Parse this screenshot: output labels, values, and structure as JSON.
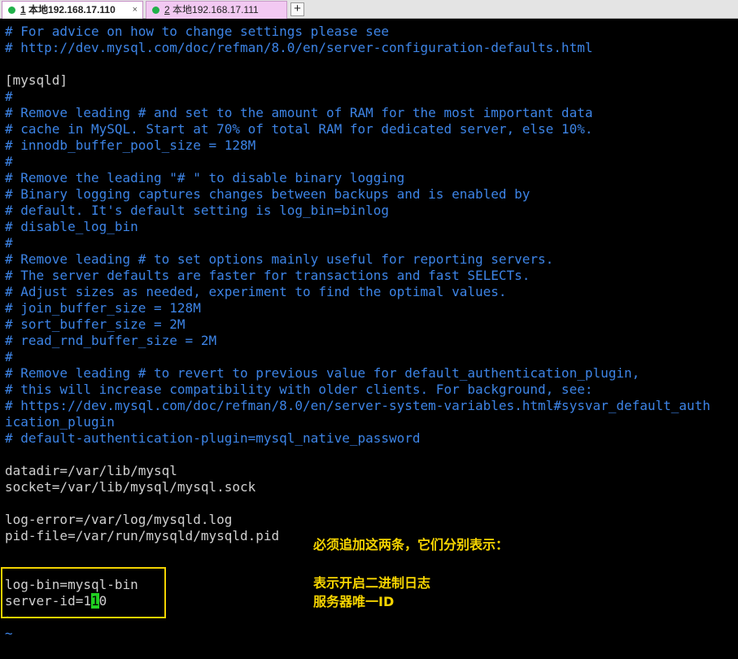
{
  "tabs": [
    {
      "num": "1",
      "label": " 本地192.168.17.110",
      "close": "×"
    },
    {
      "num": "2",
      "label": " 本地192.168.17.111"
    }
  ],
  "new_tab_label": "+",
  "lines": [
    {
      "text": "# For advice on how to change settings please see",
      "comment": true
    },
    {
      "text": "# http://dev.mysql.com/doc/refman/8.0/en/server-configuration-defaults.html",
      "comment": true
    },
    {
      "text": "",
      "comment": false
    },
    {
      "text": "[mysqld]",
      "comment": false
    },
    {
      "text": "#",
      "comment": true
    },
    {
      "text": "# Remove leading # and set to the amount of RAM for the most important data",
      "comment": true
    },
    {
      "text": "# cache in MySQL. Start at 70% of total RAM for dedicated server, else 10%.",
      "comment": true
    },
    {
      "text": "# innodb_buffer_pool_size = 128M",
      "comment": true
    },
    {
      "text": "#",
      "comment": true
    },
    {
      "text": "# Remove the leading \"# \" to disable binary logging",
      "comment": true
    },
    {
      "text": "# Binary logging captures changes between backups and is enabled by",
      "comment": true
    },
    {
      "text": "# default. It's default setting is log_bin=binlog",
      "comment": true
    },
    {
      "text": "# disable_log_bin",
      "comment": true
    },
    {
      "text": "#",
      "comment": true
    },
    {
      "text": "# Remove leading # to set options mainly useful for reporting servers.",
      "comment": true
    },
    {
      "text": "# The server defaults are faster for transactions and fast SELECTs.",
      "comment": true
    },
    {
      "text": "# Adjust sizes as needed, experiment to find the optimal values.",
      "comment": true
    },
    {
      "text": "# join_buffer_size = 128M",
      "comment": true
    },
    {
      "text": "# sort_buffer_size = 2M",
      "comment": true
    },
    {
      "text": "# read_rnd_buffer_size = 2M",
      "comment": true
    },
    {
      "text": "#",
      "comment": true
    },
    {
      "text": "# Remove leading # to revert to previous value for default_authentication_plugin,",
      "comment": true
    },
    {
      "text": "# this will increase compatibility with older clients. For background, see:",
      "comment": true
    },
    {
      "text": "# https://dev.mysql.com/doc/refman/8.0/en/server-system-variables.html#sysvar_default_auth",
      "comment": true
    },
    {
      "text": "ication_plugin",
      "comment": true
    },
    {
      "text": "# default-authentication-plugin=mysql_native_password",
      "comment": true
    },
    {
      "text": "",
      "comment": false
    },
    {
      "text": "datadir=/var/lib/mysql",
      "comment": false
    },
    {
      "text": "socket=/var/lib/mysql/mysql.sock",
      "comment": false
    },
    {
      "text": "",
      "comment": false
    },
    {
      "text": "log-error=/var/log/mysqld.log",
      "comment": false
    },
    {
      "text": "pid-file=/var/run/mysqld/mysqld.pid",
      "comment": false
    },
    {
      "text": "",
      "comment": false
    },
    {
      "text": "",
      "comment": false
    },
    {
      "text": "log-bin=mysql-bin",
      "comment": false
    }
  ],
  "cursor_line": {
    "before": "server-id=1",
    "cursor": "1",
    "after": "0"
  },
  "tildes": [
    "~",
    "~"
  ],
  "notes": {
    "heading": "必须追加这两条，它们分别表示：",
    "line1": "表示开启二进制日志",
    "line2": "服务器唯一ID"
  },
  "colors": {
    "background": "#000000",
    "comment": "#3d84e6",
    "text": "#d0d0d0",
    "cursor": "#21d021",
    "annotation": "#f7d500",
    "tab_active": "#ffffff",
    "tab_inactive": "#f2c9f2",
    "status_dot": "#21b14a"
  }
}
